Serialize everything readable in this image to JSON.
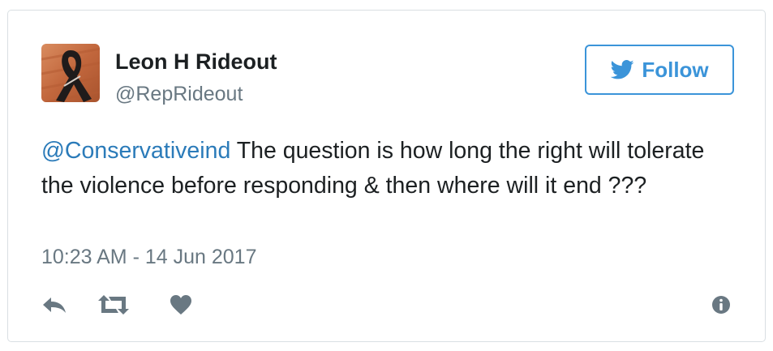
{
  "author": {
    "display_name": "Leon H Rideout",
    "handle": "@RepRideout"
  },
  "follow_button": {
    "label": "Follow"
  },
  "tweet": {
    "mention": "@Conservativeind",
    "text": " The question is how long the right will tolerate the violence before responding & then where will it end ???",
    "timestamp": "10:23 AM - 14 Jun 2017"
  },
  "actions": {
    "icons": [
      "reply-icon",
      "retweet-icon",
      "like-icon",
      "info-icon"
    ]
  },
  "colors": {
    "brand_blue": "#3b94d9",
    "link_blue": "#2b7bb9",
    "text_primary": "#1c2022",
    "text_secondary": "#697882",
    "icon_gray": "#8899a6",
    "border": "#d9dfe3"
  }
}
